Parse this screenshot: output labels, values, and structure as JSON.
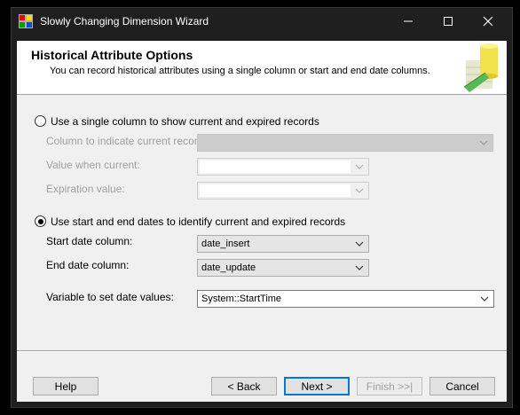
{
  "window": {
    "title": "Slowly Changing Dimension Wizard"
  },
  "header": {
    "title": "Historical Attribute Options",
    "subtitle": "You can record historical attributes using a single column or start and end date columns."
  },
  "option_single": {
    "label": "Use a single column to show current and expired records",
    "selected": false,
    "current_record_label": "Column to indicate current record:",
    "value_when_current_label": "Value when current:",
    "expiration_value_label": "Expiration value:"
  },
  "option_dates": {
    "label": "Use start and end dates to identify current and expired records",
    "selected": true,
    "start_date_label": "Start date column:",
    "start_date_value": "date_insert",
    "end_date_label": "End date column:",
    "end_date_value": "date_update",
    "variable_label": "Variable to set date values:",
    "variable_value": "System::StartTime"
  },
  "buttons": {
    "help": "Help",
    "back": "< Back",
    "next": "Next >",
    "finish": "Finish >>|",
    "cancel": "Cancel"
  },
  "colors": {
    "accent": "#0078d7",
    "titlebar": "#1f1f1f",
    "dialog_bg": "#f0f0f0"
  }
}
